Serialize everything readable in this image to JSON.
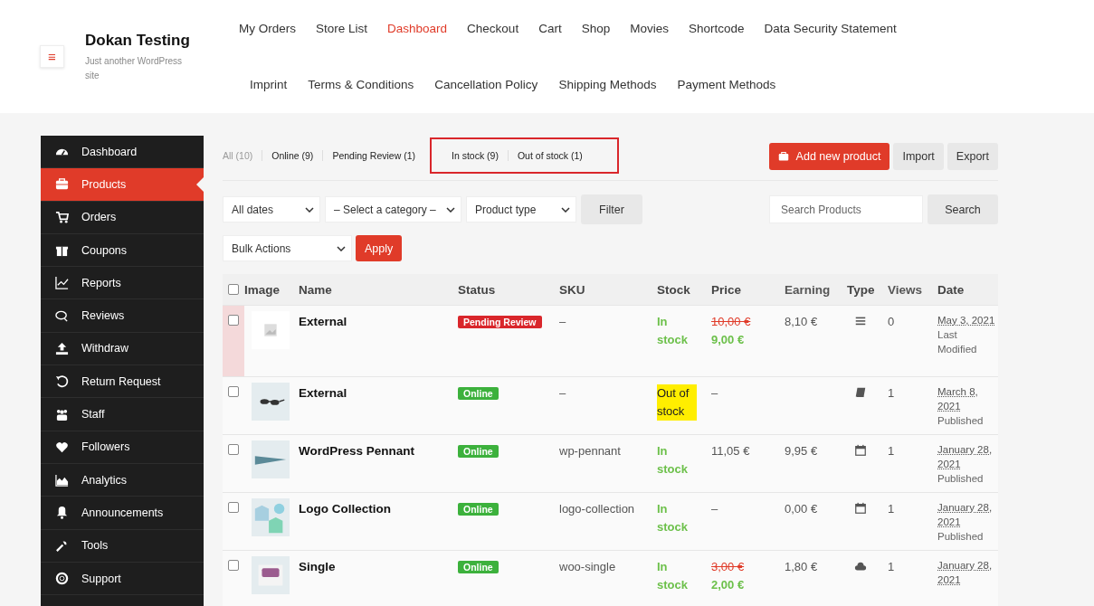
{
  "site": {
    "title": "Dokan Testing",
    "tagline": "Just another WordPress site",
    "menu_toggle": "≡"
  },
  "nav": {
    "rows": [
      {
        "items": [
          {
            "label": "My Orders",
            "selected": false
          },
          {
            "label": "Store List",
            "selected": false
          },
          {
            "label": "Dashboard",
            "selected": true
          },
          {
            "label": "Checkout",
            "selected": false
          },
          {
            "label": "Cart",
            "selected": false
          },
          {
            "label": "Shop",
            "selected": false
          },
          {
            "label": "Movies",
            "selected": false
          },
          {
            "label": "Shortcode",
            "selected": false
          },
          {
            "label": "Data Security Statement",
            "selected": false
          }
        ]
      },
      {
        "items": [
          {
            "label": "Imprint",
            "selected": false
          },
          {
            "label": "Terms & Conditions",
            "selected": false
          },
          {
            "label": "Cancellation Policy",
            "selected": false
          },
          {
            "label": "Shipping Methods",
            "selected": false
          },
          {
            "label": "Payment Methods",
            "selected": false
          }
        ]
      }
    ]
  },
  "sidebar": {
    "items": [
      {
        "label": "Dashboard",
        "selected": false
      },
      {
        "label": "Products",
        "selected": true
      },
      {
        "label": "Orders",
        "selected": false
      },
      {
        "label": "Coupons",
        "selected": false
      },
      {
        "label": "Reports",
        "selected": false
      },
      {
        "label": "Reviews",
        "selected": false
      },
      {
        "label": "Withdraw",
        "selected": false
      },
      {
        "label": "Return Request",
        "selected": false
      },
      {
        "label": "Staff",
        "selected": false
      },
      {
        "label": "Followers",
        "selected": false
      },
      {
        "label": "Analytics",
        "selected": false
      },
      {
        "label": "Announcements",
        "selected": false
      },
      {
        "label": "Tools",
        "selected": false
      },
      {
        "label": "Support",
        "selected": false
      }
    ]
  },
  "filter_groups": [
    {
      "highlighted": false,
      "items": [
        {
          "label": "All (10)",
          "selected": true
        },
        {
          "label": "Online (9)",
          "selected": false
        },
        {
          "label": "Pending Review (1)",
          "selected": false
        }
      ]
    },
    {
      "highlighted": true,
      "items": [
        {
          "label": "In stock (9)",
          "selected": false
        },
        {
          "label": "Out of stock (1)",
          "selected": false
        }
      ]
    }
  ],
  "actions": {
    "add": "Add new product",
    "import": "Import",
    "export": "Export"
  },
  "filters": {
    "dates": "All dates",
    "category": "– Select a category –",
    "type": "Product type",
    "filter_button": "Filter",
    "search_placeholder": "Search Products",
    "search_button": "Search",
    "bulk": "Bulk Actions",
    "apply": "Apply"
  },
  "table": {
    "select_all_checked": false,
    "columns": [
      "Image",
      "Name",
      "Status",
      "SKU",
      "Stock",
      "Price",
      "Earning",
      "Type",
      "Views",
      "Date"
    ],
    "rows": [
      {
        "checked": false,
        "name": "External",
        "status": {
          "kind": "pending",
          "label": "Pending Review"
        },
        "sku": "–",
        "stock": {
          "kind": "in",
          "label": "In stock"
        },
        "price": {
          "regular": "10,00 €",
          "sale": "9,00 €"
        },
        "earning": "8,10 €",
        "views": "0",
        "date": "May 3, 2021",
        "date_note": "Last Modified"
      },
      {
        "checked": false,
        "name": "External",
        "status": {
          "kind": "online",
          "label": "Online"
        },
        "sku": "–",
        "stock": {
          "kind": "out",
          "label": "Out of stock"
        },
        "price": {
          "regular": "–"
        },
        "earning": "",
        "views": "1",
        "date": "March 8, 2021",
        "date_note": "Published"
      },
      {
        "checked": false,
        "name": "WordPress Pennant",
        "status": {
          "kind": "online",
          "label": "Online"
        },
        "sku": "wp-pennant",
        "stock": {
          "kind": "in",
          "label": "In stock"
        },
        "price": {
          "regular": "11,05 €"
        },
        "earning": "9,95 €",
        "views": "1",
        "date": "January 28, 2021",
        "date_note": "Published"
      },
      {
        "checked": false,
        "name": "Logo Collection",
        "status": {
          "kind": "online",
          "label": "Online"
        },
        "sku": "logo-collection",
        "stock": {
          "kind": "in",
          "label": "In stock"
        },
        "price": {
          "regular": "–"
        },
        "earning": "0,00 €",
        "views": "1",
        "date": "January 28, 2021",
        "date_note": "Published"
      },
      {
        "checked": false,
        "name": "Single",
        "status": {
          "kind": "online",
          "label": "Online"
        },
        "sku": "woo-single",
        "stock": {
          "kind": "in",
          "label": "In stock"
        },
        "price": {
          "regular": "3,00 €",
          "sale": "2,00 €"
        },
        "earning": "1,80 €",
        "views": "1",
        "date": "January 28, 2021"
      }
    ]
  }
}
